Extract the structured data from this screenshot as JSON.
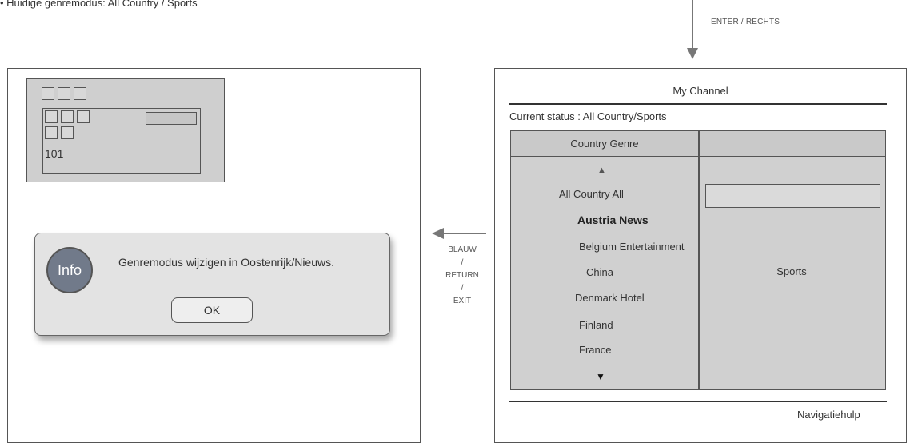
{
  "caption": "• Huidige genremodus: All Country / Sports",
  "enter_label": "ENTER / RECHTS",
  "left_screen": {
    "channel_number": "101",
    "dialog": {
      "icon_label": "Info",
      "message": "Genremodus wijzigen in Oostenrijk/Nieuws.",
      "ok_label": "OK"
    }
  },
  "side_labels": [
    "BLAUW",
    "/",
    "RETURN",
    "/",
    "EXIT"
  ],
  "right_screen": {
    "title": "My Channel",
    "status": "Current status : All Country/Sports",
    "column_header": "Country Genre",
    "up_arrow": "▲",
    "down_arrow": "▼",
    "list": [
      {
        "label": "All Country All",
        "selected": false
      },
      {
        "label": "Austria News",
        "selected": true
      },
      {
        "label": "Belgium Entertainment",
        "selected": false
      },
      {
        "label": "China",
        "selected": false
      },
      {
        "label": "Denmark Hotel",
        "selected": false
      },
      {
        "label": "Finland",
        "selected": false
      },
      {
        "label": "France",
        "selected": false
      }
    ],
    "genre_value": "Sports",
    "nav_help": "Navigatiehulp"
  }
}
